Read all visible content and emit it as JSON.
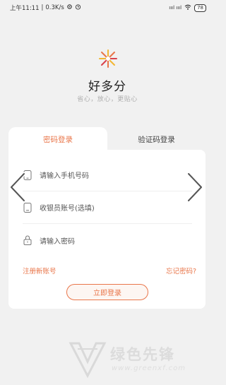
{
  "status_bar": {
    "time": "上午11:11",
    "speed": "0.3K/s",
    "signal": "ıııl ıııl",
    "battery": "78"
  },
  "app": {
    "name": "好多分",
    "slogan": "省心，放心，更贴心"
  },
  "tabs": [
    {
      "label": "密码登录",
      "active": true
    },
    {
      "label": "验证码登录",
      "active": false
    }
  ],
  "form": {
    "phone_placeholder": "请输入手机号码",
    "cashier_placeholder": "收银员账号(选填)",
    "password_placeholder": "请输入密码"
  },
  "links": {
    "register": "注册新账号",
    "forgot": "忘记密码?"
  },
  "login_button": "立即登录",
  "watermark": {
    "text": "绿色先锋",
    "url": "www.greenxf.com"
  },
  "colors": {
    "accent": "#e9764a",
    "background": "#f1f1f1"
  },
  "icons": [
    "alarm-icon",
    "settings-icon",
    "wifi-icon",
    "phone-icon",
    "cashier-icon",
    "lock-icon",
    "chevron-left-icon",
    "chevron-right-icon"
  ]
}
